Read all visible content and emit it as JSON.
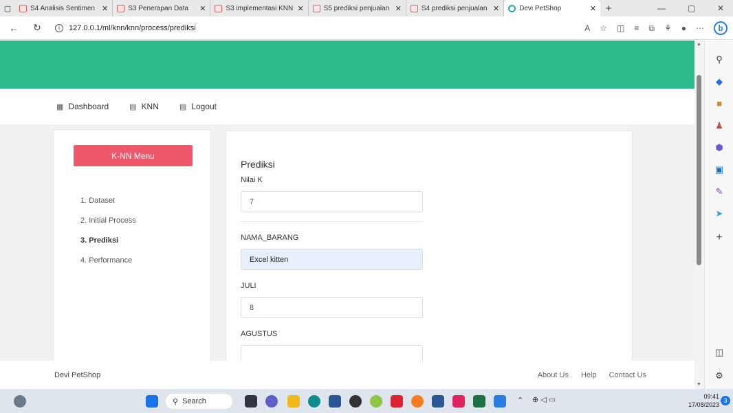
{
  "browser": {
    "tabs": [
      {
        "title": "S4 Analisis Sentimen",
        "active": false
      },
      {
        "title": "S3 Penerapan Data",
        "active": false
      },
      {
        "title": "S3 implementasi KNN",
        "active": false
      },
      {
        "title": "S5 prediksi penjualan",
        "active": false
      },
      {
        "title": "S4 prediksi penjualan",
        "active": false
      },
      {
        "title": "Devi PetShop",
        "active": true
      }
    ],
    "url": "127.0.0.1/ml/knn/knn/process/prediksi"
  },
  "nav": {
    "items": [
      {
        "label": "Dashboard"
      },
      {
        "label": "KNN"
      },
      {
        "label": "Logout"
      }
    ]
  },
  "sidebar": {
    "button": "K-NN Menu",
    "links": [
      {
        "label": "1. Dataset"
      },
      {
        "label": "2. Initial Process"
      },
      {
        "label": "3. Prediksi"
      },
      {
        "label": "4. Performance"
      }
    ],
    "active_index": 2
  },
  "form": {
    "title": "Prediksi",
    "k_label": "Nilai K",
    "k_value": "7",
    "nama_label": "NAMA_BARANG",
    "nama_value": "Excel kitten",
    "juli_label": "JULI",
    "juli_value": "8",
    "agustus_label": "AGUSTUS",
    "agustus_value": ""
  },
  "footer": {
    "brand": "Devi PetShop",
    "links": [
      "About Us",
      "Help",
      "Contact Us"
    ]
  },
  "taskbar": {
    "search": "Search",
    "time": "09:41",
    "date": "17/08/2023"
  },
  "colors": {
    "hero": "#2bbb8c",
    "menu_button": "#f0576a"
  }
}
